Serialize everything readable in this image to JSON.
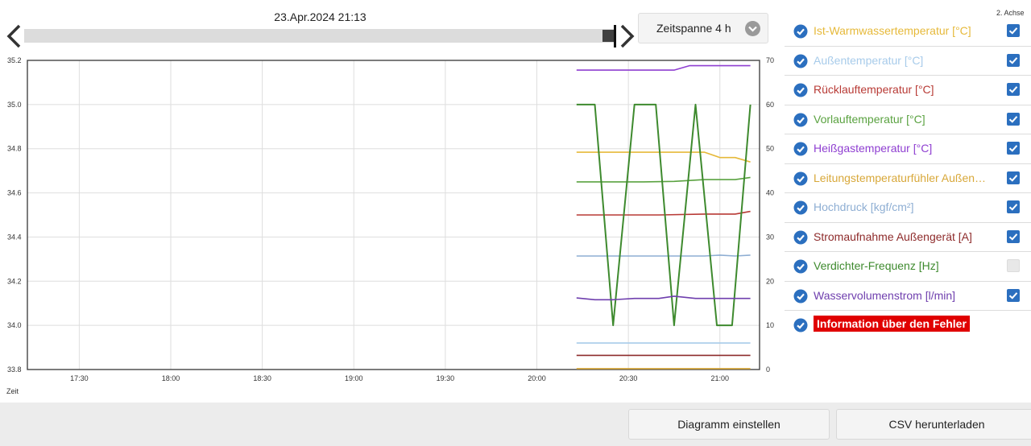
{
  "header": {
    "timestamp": "23.Apr.2024 21:13",
    "timespan_label": "Zeitspanne 4 h"
  },
  "chart": {
    "x_axis_caption": "Zeit",
    "second_axis_caption": "2. Achse"
  },
  "legend": {
    "items": [
      {
        "label": "Ist-Warmwassertemperatur [°C]",
        "color": "#e6b93a",
        "checked": true,
        "second_axis": true
      },
      {
        "label": "Außentemperatur [°C]",
        "color": "#a7cbea",
        "checked": true,
        "second_axis": true
      },
      {
        "label": "Rücklauftemperatur [°C]",
        "color": "#b83a35",
        "checked": true,
        "second_axis": true
      },
      {
        "label": "Vorlauftemperatur [°C]",
        "color": "#5aa240",
        "checked": true,
        "second_axis": true
      },
      {
        "label": "Heißgastemperatur [°C]",
        "color": "#8f3fd1",
        "checked": true,
        "second_axis": true
      },
      {
        "label": "Leitungstemperaturfühler Außengerät [°C]",
        "color": "#d8a83a",
        "checked": true,
        "second_axis": true
      },
      {
        "label": "Hochdruck [kgf/cm²]",
        "color": "#8eaed3",
        "checked": true,
        "second_axis": true
      },
      {
        "label": "Stromaufnahme Außengerät [A]",
        "color": "#8e2b2b",
        "checked": true,
        "second_axis": true
      },
      {
        "label": "Verdichter-Frequenz [Hz]",
        "color": "#3e8a2e",
        "checked": true,
        "second_axis": false
      },
      {
        "label": "Wasservolumenstrom [l/min]",
        "color": "#6f3fae",
        "checked": true,
        "second_axis": true
      }
    ],
    "error_item": {
      "label": "Information über den Fehler",
      "checked": true
    }
  },
  "footer": {
    "configure_label": "Diagramm einstellen",
    "csv_label": "CSV herunterladen"
  },
  "chart_data": {
    "type": "line",
    "x_ticks": [
      "17:30",
      "18:00",
      "18:30",
      "19:00",
      "19:30",
      "20:00",
      "20:30",
      "21:00"
    ],
    "x_range": [
      "17:13",
      "21:13"
    ],
    "y_ticks": [
      "35.2",
      "35.0",
      "34.8",
      "34.6",
      "34.4",
      "34.2",
      "34.0",
      "33.8"
    ],
    "ylim": [
      33.8,
      35.2
    ],
    "y2_ticks": [
      "70",
      "60",
      "50",
      "40",
      "30",
      "20",
      "10",
      "0"
    ],
    "y2lim": [
      0,
      70
    ],
    "grid": true,
    "series": [
      {
        "name": "Ist-Warmwassertemperatur [°C]",
        "color": "#e6b93a",
        "axis": "y2",
        "x": [
          "20:13",
          "20:40",
          "20:55",
          "21:00",
          "21:05",
          "21:10"
        ],
        "values": [
          49.2,
          49.2,
          49.2,
          48.0,
          48.0,
          47.0
        ]
      },
      {
        "name": "Außentemperatur [°C]",
        "color": "#a7cbea",
        "axis": "y2",
        "x": [
          "20:13",
          "21:10"
        ],
        "values": [
          6.0,
          6.0
        ]
      },
      {
        "name": "Rücklauftemperatur [°C]",
        "color": "#b83a35",
        "axis": "y2",
        "x": [
          "20:13",
          "20:40",
          "20:55",
          "21:05",
          "21:10"
        ],
        "values": [
          35.0,
          35.0,
          35.2,
          35.2,
          35.8
        ]
      },
      {
        "name": "Vorlauftemperatur [°C]",
        "color": "#5aa240",
        "axis": "y2",
        "x": [
          "20:13",
          "20:35",
          "20:45",
          "20:55",
          "21:05",
          "21:10"
        ],
        "values": [
          42.5,
          42.5,
          42.6,
          43.0,
          43.0,
          43.5
        ]
      },
      {
        "name": "Heißgastemperatur [°C]",
        "color": "#8f3fd1",
        "axis": "y2",
        "x": [
          "20:13",
          "20:45",
          "20:50",
          "21:10"
        ],
        "values": [
          67.8,
          67.8,
          68.8,
          68.8
        ]
      },
      {
        "name": "Leitungstemperaturfühler Außengerät [°C]",
        "color": "#d8a83a",
        "axis": "y2",
        "x": [
          "20:13",
          "21:10"
        ],
        "values": [
          0.2,
          0.2
        ]
      },
      {
        "name": "Hochdruck [kgf/cm²]",
        "color": "#8eaed3",
        "axis": "y2",
        "x": [
          "20:13",
          "20:40",
          "20:55",
          "21:00",
          "21:05",
          "21:10"
        ],
        "values": [
          25.7,
          25.7,
          25.7,
          25.9,
          25.7,
          25.9
        ]
      },
      {
        "name": "Stromaufnahme Außengerät [A]",
        "color": "#8e2b2b",
        "axis": "y2",
        "x": [
          "20:13",
          "21:10"
        ],
        "values": [
          3.2,
          3.2
        ]
      },
      {
        "name": "Verdichter-Frequenz [Hz]",
        "color": "#3e8a2e",
        "axis": "y1",
        "x": [
          "20:13",
          "20:19",
          "20:25",
          "20:32",
          "20:39",
          "20:45",
          "20:52",
          "20:59",
          "21:04",
          "21:10"
        ],
        "values": [
          35.0,
          35.0,
          34.0,
          35.0,
          35.0,
          34.0,
          35.0,
          34.0,
          34.0,
          35.0
        ]
      },
      {
        "name": "Wasservolumenstrom [l/min]",
        "color": "#6f3fae",
        "axis": "y2",
        "x": [
          "20:13",
          "20:19",
          "20:25",
          "20:32",
          "20:40",
          "20:45",
          "20:52",
          "20:58",
          "21:10"
        ],
        "values": [
          16.2,
          15.8,
          15.8,
          16.1,
          16.1,
          16.6,
          16.1,
          16.1,
          16.1
        ]
      }
    ]
  }
}
